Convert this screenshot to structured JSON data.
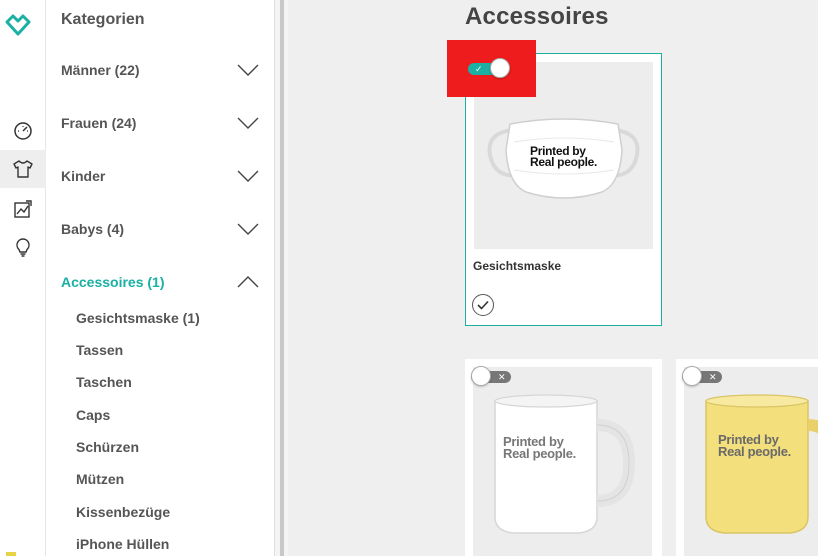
{
  "sidebar": {
    "title": "Kategorien",
    "categories": [
      {
        "label": "Männer (22)",
        "expanded": false
      },
      {
        "label": "Frauen (24)",
        "expanded": false
      },
      {
        "label": "Kinder",
        "expanded": false
      },
      {
        "label": "Babys (4)",
        "expanded": false
      },
      {
        "label": "Accessoires (1)",
        "expanded": true
      }
    ],
    "subcategories": [
      "Gesichtsmaske (1)",
      "Tassen",
      "Taschen",
      "Caps",
      "Schürzen",
      "Mützen",
      "Kissenbezüge",
      "iPhone Hüllen"
    ]
  },
  "rail": {
    "icons": [
      "logo-icon",
      "speedometer-icon",
      "tshirt-icon",
      "image-chart-icon",
      "lightbulb-icon"
    ]
  },
  "main": {
    "title": "Accessoires",
    "products": [
      {
        "name": "Gesichtsmaske",
        "enabled": true,
        "selected": true,
        "print_line1": "Printed by",
        "print_line2": "Real people."
      },
      {
        "name": "",
        "enabled": false,
        "selected": false,
        "print_line1": "Printed by",
        "print_line2": "Real people."
      },
      {
        "name": "",
        "enabled": false,
        "selected": false,
        "print_line1": "Printed by",
        "print_line2": "Real people."
      }
    ]
  },
  "colors": {
    "accent": "#1ab0a3",
    "highlight": "#ee1c1c",
    "mug_yellow": "#f3df7c"
  }
}
